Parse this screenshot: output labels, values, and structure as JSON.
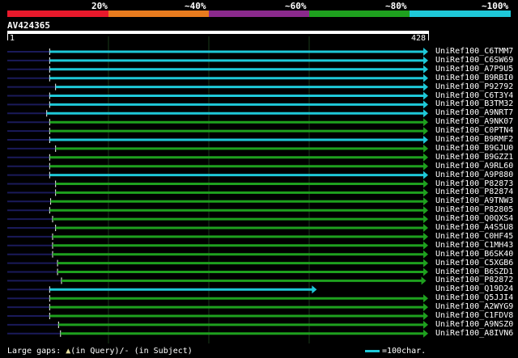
{
  "header": {
    "percent_labels": [
      "20%",
      "~40%",
      "~60%",
      "~80%",
      "~100%"
    ],
    "scale_colors": [
      "#e8192b",
      "#e87b1e",
      "#8a2a8c",
      "#1ea01e",
      "#1ec8d8"
    ]
  },
  "query": {
    "id": "AV424365",
    "start": "1",
    "end": "428",
    "length": 428
  },
  "colors": {
    "cyan": "#1ec8d8",
    "green": "#1ea01e",
    "grid": "#1a3a1a",
    "navy": "#1a1a5a"
  },
  "hits": [
    {
      "id": "UniRef100_C6TMM7",
      "start": 44,
      "end": 428,
      "color": "cyan"
    },
    {
      "id": "UniRef100_C6SW69",
      "start": 44,
      "end": 428,
      "color": "cyan"
    },
    {
      "id": "UniRef100_A7P9U5",
      "start": 44,
      "end": 428,
      "color": "cyan"
    },
    {
      "id": "UniRef100_B9RBI0",
      "start": 44,
      "end": 428,
      "color": "cyan"
    },
    {
      "id": "UniRef100_P92792",
      "start": 50,
      "end": 428,
      "color": "cyan"
    },
    {
      "id": "UniRef100_C6T3Y4",
      "start": 44,
      "end": 428,
      "color": "cyan"
    },
    {
      "id": "UniRef100_B3TM32",
      "start": 44,
      "end": 428,
      "color": "cyan"
    },
    {
      "id": "UniRef100_A9NRT7",
      "start": 41,
      "end": 428,
      "color": "cyan"
    },
    {
      "id": "UniRef100_A9NK07",
      "start": 44,
      "end": 428,
      "color": "green"
    },
    {
      "id": "UniRef100_C0PTN4",
      "start": 44,
      "end": 428,
      "color": "green"
    },
    {
      "id": "UniRef100_B9RMF2",
      "start": 44,
      "end": 428,
      "color": "cyan"
    },
    {
      "id": "UniRef100_B9GJU0",
      "start": 50,
      "end": 428,
      "color": "green"
    },
    {
      "id": "UniRef100_B9GZZ1",
      "start": 44,
      "end": 428,
      "color": "green"
    },
    {
      "id": "UniRef100_A9RL60",
      "start": 44,
      "end": 428,
      "color": "green"
    },
    {
      "id": "UniRef100_A9P880",
      "start": 44,
      "end": 428,
      "color": "cyan"
    },
    {
      "id": "UniRef100_P82873",
      "start": 50,
      "end": 428,
      "color": "green"
    },
    {
      "id": "UniRef100_P82874",
      "start": 50,
      "end": 428,
      "color": "green"
    },
    {
      "id": "UniRef100_A9TNW3",
      "start": 45,
      "end": 428,
      "color": "green"
    },
    {
      "id": "UniRef100_P82805",
      "start": 44,
      "end": 428,
      "color": "green"
    },
    {
      "id": "UniRef100_Q0QXS4",
      "start": 47,
      "end": 428,
      "color": "green"
    },
    {
      "id": "UniRef100_A4S5U8",
      "start": 50,
      "end": 428,
      "color": "green"
    },
    {
      "id": "UniRef100_C0HF45",
      "start": 47,
      "end": 428,
      "color": "green"
    },
    {
      "id": "UniRef100_C1MH43",
      "start": 47,
      "end": 428,
      "color": "green"
    },
    {
      "id": "UniRef100_B6SK40",
      "start": 47,
      "end": 428,
      "color": "green"
    },
    {
      "id": "UniRef100_C5XGB6",
      "start": 52,
      "end": 428,
      "color": "green"
    },
    {
      "id": "UniRef100_B6SZD1",
      "start": 52,
      "end": 428,
      "color": "green"
    },
    {
      "id": "UniRef100_P82872",
      "start": 56,
      "end": 426,
      "color": "green"
    },
    {
      "id": "UniRef100_Q19D24",
      "start": 44,
      "end": 315,
      "color": "cyan"
    },
    {
      "id": "UniRef100_Q5JJI4",
      "start": 44,
      "end": 428,
      "color": "green"
    },
    {
      "id": "UniRef100_A2WYG9",
      "start": 44,
      "end": 428,
      "color": "green"
    },
    {
      "id": "UniRef100_C1FDV8",
      "start": 44,
      "end": 428,
      "color": "green"
    },
    {
      "id": "UniRef100_A9NSZ0",
      "start": 53,
      "end": 428,
      "color": "green"
    },
    {
      "id": "UniRef100_A8IVN6",
      "start": 55,
      "end": 428,
      "color": "green"
    }
  ],
  "footer": {
    "gaps_label": "Large gaps:",
    "gap_query": "(in Query)/",
    "gap_subject": "- (in Subject)",
    "scale_label": "=100char."
  }
}
